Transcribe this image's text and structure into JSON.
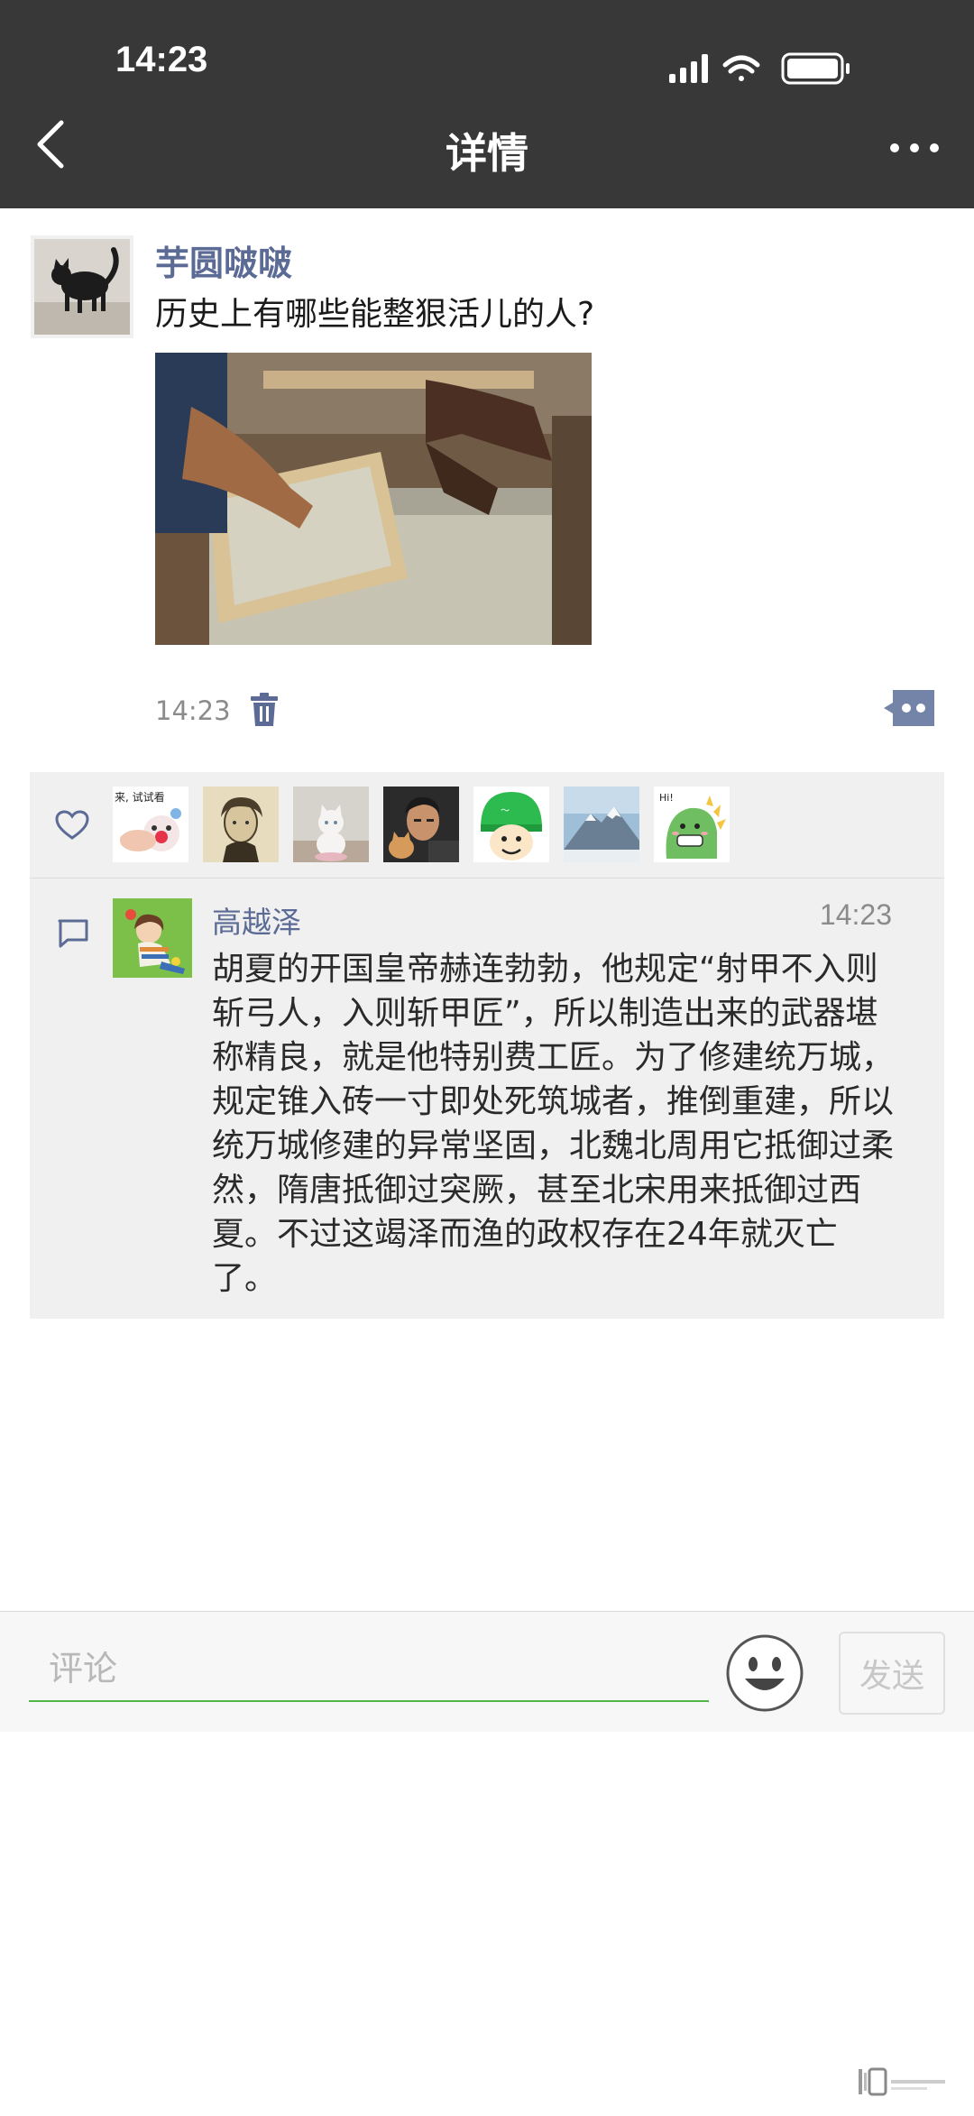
{
  "status_bar": {
    "time": "14:23"
  },
  "header": {
    "title": "详情"
  },
  "post": {
    "author": "芋圆啵啵",
    "text": "历史上有哪些能整狠活儿的人?",
    "time": "14:23"
  },
  "likes": {
    "avatars": [
      {
        "name": "pointing-clown-sticker",
        "caption": "来, 试试看"
      },
      {
        "name": "beethoven-portrait"
      },
      {
        "name": "white-cat-photo"
      },
      {
        "name": "man-with-cat-photo"
      },
      {
        "name": "green-helmet-emoji"
      },
      {
        "name": "mountain-photo"
      },
      {
        "name": "dinosaur-cartoon",
        "caption": "Hi!"
      }
    ]
  },
  "comment": {
    "author": "高越泽",
    "time": "14:23",
    "text": "胡夏的开国皇帝赫连勃勃，他规定“射甲不入则斩弓人，入则斩甲匠”，所以制造出来的武器堪称精良，就是他特别费工匠。为了修建统万城，规定锥入砖一寸即处死筑城者，推倒重建，所以统万城修建的异常坚固，北魏北周用它抵御过柔然，隋唐抵御过突厥，甚至北宋用来抵御过西夏。不过这竭泽而渔的政权存在24年就灭亡了。"
  },
  "input": {
    "placeholder": "评论",
    "send_label": "发送"
  },
  "colors": {
    "header_bg": "#383838",
    "name_blue": "#5b6b95",
    "input_underline": "#50b64a",
    "panel_bg": "#f0f0f0"
  }
}
